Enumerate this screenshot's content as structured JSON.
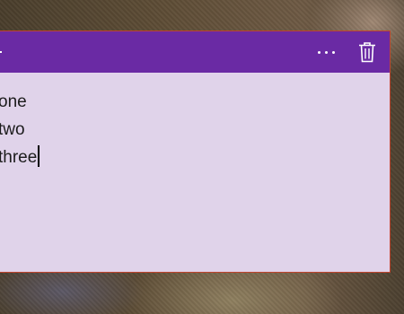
{
  "note": {
    "lines": [
      "one",
      "two",
      "three"
    ]
  },
  "colors": {
    "titlebar": "#6a2aa4",
    "body": "#e0d3ea",
    "border": "#c0442e",
    "text": "#1c1c1c"
  },
  "icons": {
    "add": "plus-icon",
    "more": "more-horizontal-icon",
    "delete": "trash-icon"
  }
}
